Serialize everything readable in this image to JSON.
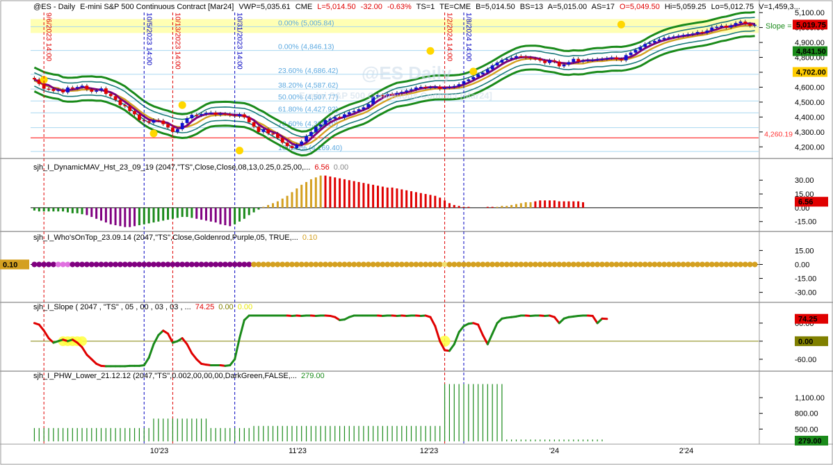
{
  "header": {
    "symbol": "@ES - Daily",
    "contract": "E-mini S&P 500 Continuous Contract [Mar24]",
    "vwp": "VWP=5,035.61",
    "exchange": "CME",
    "last": "L=5,014.50",
    "change": "-32.00",
    "change_pct": "-0.63%",
    "ts": "TS=1",
    "te": "TE=CME",
    "bid": "B=5,014.50",
    "bs": "BS=13",
    "ask": "A=5,015.00",
    "as": "AS=17",
    "open": "O=5,049.50",
    "high": "Hi=5,059.25",
    "low": "Lo=5,012.75",
    "volume": "V=1,459,3..."
  },
  "watermark": {
    "line1": "@ES Daily",
    "line2": "E-mini S&P 500 Continuous Contract [Mar24]"
  },
  "colors": {
    "up_candle": "#1010d0",
    "down_candle": "#e00000",
    "band_outer": "#1a8a1a",
    "band_inner": "#1a7a7a",
    "ma_purple": "#800080",
    "ma_gold": "#d4a020",
    "fib_line": "#a8d8f0",
    "support_line": "#ff3333",
    "highlight_band": "#ffff80"
  },
  "chart_data": [
    {
      "type": "candlestick",
      "panel": "price",
      "x_tick_labels": [
        "10'23",
        "11'23",
        "12'23",
        "'24",
        "2'24"
      ],
      "y_ticks": [
        4200,
        4300,
        4400,
        4500,
        4600,
        4700,
        4800,
        4900,
        5000,
        5100
      ],
      "y_tick_labels": [
        "4,200.00",
        "4,300.00",
        "4,400.00",
        "4,500.00",
        "4,600.00",
        "4,700.00",
        "4,800.00",
        "4,900.00",
        "5,000.00",
        "5,100.00"
      ],
      "ylim": [
        4150,
        5110
      ],
      "closes": [
        4652,
        4622,
        4590,
        4588,
        4575,
        4582,
        4565,
        4598,
        4592,
        4601,
        4610,
        4585,
        4570,
        4578,
        4592,
        4555,
        4540,
        4515,
        4480,
        4472,
        4440,
        4418,
        4380,
        4372,
        4362,
        4380,
        4376,
        4352,
        4330,
        4300,
        4318,
        4360,
        4392,
        4415,
        4412,
        4420,
        4428,
        4430,
        4415,
        4422,
        4420,
        4412,
        4405,
        4418,
        4398,
        4365,
        4335,
        4300,
        4318,
        4290,
        4288,
        4260,
        4228,
        4205,
        4192,
        4215,
        4236,
        4272,
        4300,
        4335,
        4350,
        4380,
        4389,
        4400,
        4396,
        4418,
        4432,
        4440,
        4452,
        4465,
        4487,
        4537,
        4547,
        4543,
        4554,
        4552,
        4562,
        4568,
        4578,
        4585,
        4598,
        4602,
        4598,
        4600,
        4604,
        4588,
        4598,
        4602,
        4608,
        4620,
        4640,
        4652,
        4668,
        4686,
        4698,
        4720,
        4746,
        4765,
        4783,
        4790,
        4797,
        4808,
        4805,
        4798,
        4792,
        4790,
        4778,
        4762,
        4780,
        4772,
        4740,
        4752,
        4768,
        4790,
        4772,
        4778,
        4782,
        4785,
        4788,
        4790,
        4795,
        4800,
        4788,
        4780,
        4815,
        4832,
        4850,
        4870,
        4890,
        4898,
        4910,
        4920,
        4930,
        4935,
        4940,
        4945,
        4950,
        4955,
        4960,
        4970,
        4965,
        4980,
        5000,
        5005,
        5012,
        5000,
        5015,
        5030,
        5040,
        5025,
        5012,
        5019
      ],
      "price_labels": [
        {
          "text": "5,019.75",
          "value": 5019.75,
          "bg": "#e00000",
          "fg": "#ffffff"
        },
        {
          "text": "4,841.50",
          "value": 4841.5,
          "bg": "#1a8a1a",
          "fg": "#ffffff"
        },
        {
          "text": "4,702.00",
          "value": 4702,
          "bg": "#ffcc00",
          "fg": "#000000"
        }
      ],
      "support_level": {
        "value": 4260.19,
        "label": "4,260.19"
      },
      "slope_label": "Slope =",
      "fib_levels": [
        {
          "label": "0.00% (5,005.84)",
          "value": 5005.84
        },
        {
          "label": "0.00% (4,846.13)",
          "value": 4846.13
        },
        {
          "label": "23.60% (4,686.42)",
          "value": 4686.42
        },
        {
          "label": "38.20% (4,587.62)",
          "value": 4587.62
        },
        {
          "label": "50.00% (4,507.77)",
          "value": 4507.77
        },
        {
          "label": "61.80% (4,427.92)",
          "value": 4427.92
        },
        {
          "label": "78.60% (4,329.10)",
          "value": 4329.1
        },
        {
          "label": "100.00% (4,169.40)",
          "value": 4169.4
        }
      ],
      "vertical_markers": [
        {
          "label": "9/6/2023 14:00",
          "bar": 2,
          "color": "#e00000"
        },
        {
          "label": "10/5/2023 14:00",
          "bar": 23,
          "color": "#0000c0"
        },
        {
          "label": "10/13/2023 14:00",
          "bar": 29,
          "color": "#e00000"
        },
        {
          "label": "10/31/2023 14:00",
          "bar": 42,
          "color": "#0000c0"
        },
        {
          "label": "1/2/2024 14:00",
          "bar": 86,
          "color": "#e00000"
        },
        {
          "label": "1/8/2024 14:00",
          "bar": 90,
          "color": "#0000c0"
        }
      ]
    },
    {
      "type": "bar",
      "panel": "dynamic_mav",
      "title": "sjh_I_DynamicMAV_Hst_23_09_19 (2047,\"TS\",Close,Close,08,13,0.25,0.25,00,...",
      "value1": "6.56",
      "value2": "0.00",
      "last_label": "6.56",
      "y_ticks": [
        30,
        15,
        0,
        -15
      ],
      "y_tick_labels": [
        "30.00",
        "15.00",
        "0.00",
        "-15.00"
      ],
      "ylim": [
        -22,
        40
      ],
      "values": [
        -3,
        -4,
        -4,
        -4,
        -4,
        -4,
        -4,
        -5,
        -6,
        -6,
        -7,
        -8,
        -10,
        -12,
        -14,
        -16,
        -18,
        -19,
        -20,
        -21,
        -21,
        -20,
        -19,
        -18,
        -17,
        -16,
        -15,
        -14,
        -13,
        -12,
        -11,
        -10,
        -10,
        -11,
        -12,
        -13,
        -14,
        -15,
        -16,
        -18,
        -19,
        -20,
        -18,
        -15,
        -12,
        -8,
        -5,
        -2,
        1,
        3,
        5,
        7,
        10,
        13,
        17,
        21,
        25,
        28,
        31,
        33,
        35,
        35,
        34,
        33,
        32,
        31,
        30,
        29,
        28,
        27,
        26,
        25,
        24,
        23,
        22,
        22,
        21,
        20,
        19,
        18,
        17,
        16,
        15,
        14,
        13,
        11,
        8,
        5,
        3,
        2,
        1,
        1,
        0,
        0,
        0,
        1,
        1,
        1,
        2,
        2,
        3,
        4,
        5,
        6,
        6,
        7,
        8,
        8,
        8,
        8,
        7,
        7,
        7,
        7,
        7,
        6
      ],
      "sign_flip_bars": {
        "gold_start": 48,
        "red_start": 61,
        "gold2_start": 97,
        "red2_start": 105
      }
    },
    {
      "type": "scatter",
      "panel": "whos_on_top",
      "title": "sjh_I_Who'sOnTop_23.09.14 (2047,\"TS\",Close,Goldenrod,Purple,05,  TRUE,...",
      "value1": "0.10",
      "last_label": "0.10",
      "y_ticks": [
        15,
        0,
        -15,
        -30
      ],
      "y_tick_labels": [
        "15.00",
        "0.00",
        "-15.00",
        "-30.00"
      ],
      "ylim": [
        -37,
        22
      ],
      "purple_until_bar": 46,
      "pink_bars": [
        5,
        6,
        7
      ]
    },
    {
      "type": "line",
      "panel": "slope",
      "title": "sjh_I_Slope ( 2047 , \"TS\" , 05 , 00 , 03 , 03 , ...",
      "value1": "74.25",
      "value2": "0.00",
      "value3": "0.00",
      "last_label": "74.25",
      "zero_label": "0.00",
      "y_ticks": [
        60,
        0,
        -60
      ],
      "y_tick_labels": [
        "60.00",
        "0.00",
        "-60.00"
      ],
      "ylim": [
        -88,
        92
      ],
      "values": [
        60,
        55,
        35,
        10,
        -5,
        0,
        5,
        0,
        5,
        -5,
        -20,
        -45,
        -60,
        -75,
        -82,
        -83,
        -83,
        -83,
        -83,
        -83,
        -82,
        -82,
        -82,
        -80,
        -55,
        -10,
        20,
        35,
        25,
        -5,
        0,
        10,
        -10,
        -40,
        -60,
        -75,
        -78,
        -80,
        -80,
        -80,
        -82,
        -80,
        -60,
        10,
        70,
        85,
        85,
        85,
        85,
        85,
        85,
        85,
        85,
        85,
        84,
        85,
        84,
        85,
        85,
        84,
        85,
        85,
        84,
        80,
        70,
        72,
        80,
        85,
        85,
        85,
        85,
        85,
        85,
        84,
        85,
        85,
        84,
        85,
        84,
        85,
        85,
        84,
        85,
        80,
        50,
        0,
        -30,
        -32,
        -10,
        30,
        50,
        58,
        60,
        55,
        20,
        -10,
        25,
        60,
        75,
        78,
        80,
        82,
        85,
        85,
        84,
        85,
        85,
        84,
        85,
        80,
        60,
        75,
        80,
        82,
        84,
        85,
        85,
        84,
        60,
        75,
        74
      ],
      "highlights": [
        {
          "from_bar": 6,
          "to_bar": 10,
          "value": 0
        },
        {
          "bar": 86,
          "value": 0
        }
      ]
    },
    {
      "type": "bar",
      "panel": "phw_lower",
      "title": "sjh_I_PHW_Lower_21.12.12 (2047,\"TS\",0.002,00,00,00,DarkGreen,FALSE,...",
      "value1": "279.00",
      "last_label": "279.00",
      "y_ticks": [
        1100,
        800,
        500
      ],
      "y_tick_labels": [
        "1,100.00",
        "800.00",
        "500.00"
      ],
      "ylim": [
        265,
        1420
      ],
      "values": [
        520,
        520,
        520,
        520,
        520,
        520,
        520,
        520,
        520,
        520,
        520,
        520,
        520,
        520,
        520,
        520,
        520,
        520,
        520,
        520,
        520,
        520,
        520,
        520,
        520,
        700,
        700,
        700,
        700,
        700,
        700,
        700,
        700,
        700,
        700,
        700,
        700,
        520,
        520,
        520,
        520,
        520,
        520,
        520,
        520,
        520,
        560,
        560,
        560,
        560,
        560,
        560,
        560,
        560,
        560,
        560,
        560,
        560,
        560,
        560,
        560,
        560,
        560,
        560,
        560,
        560,
        560,
        560,
        560,
        560,
        560,
        560,
        560,
        560,
        560,
        560,
        560,
        560,
        560,
        560,
        560,
        560,
        560,
        560,
        560,
        560,
        1360,
        1360,
        1360,
        1360,
        1360,
        1360,
        1360,
        1360,
        1360,
        1360,
        1360,
        1360,
        1360,
        300,
        300,
        300,
        300,
        300,
        300,
        300,
        300,
        300,
        300,
        300,
        300,
        300,
        300,
        300,
        300,
        300,
        300,
        300,
        300,
        300
      ]
    }
  ]
}
